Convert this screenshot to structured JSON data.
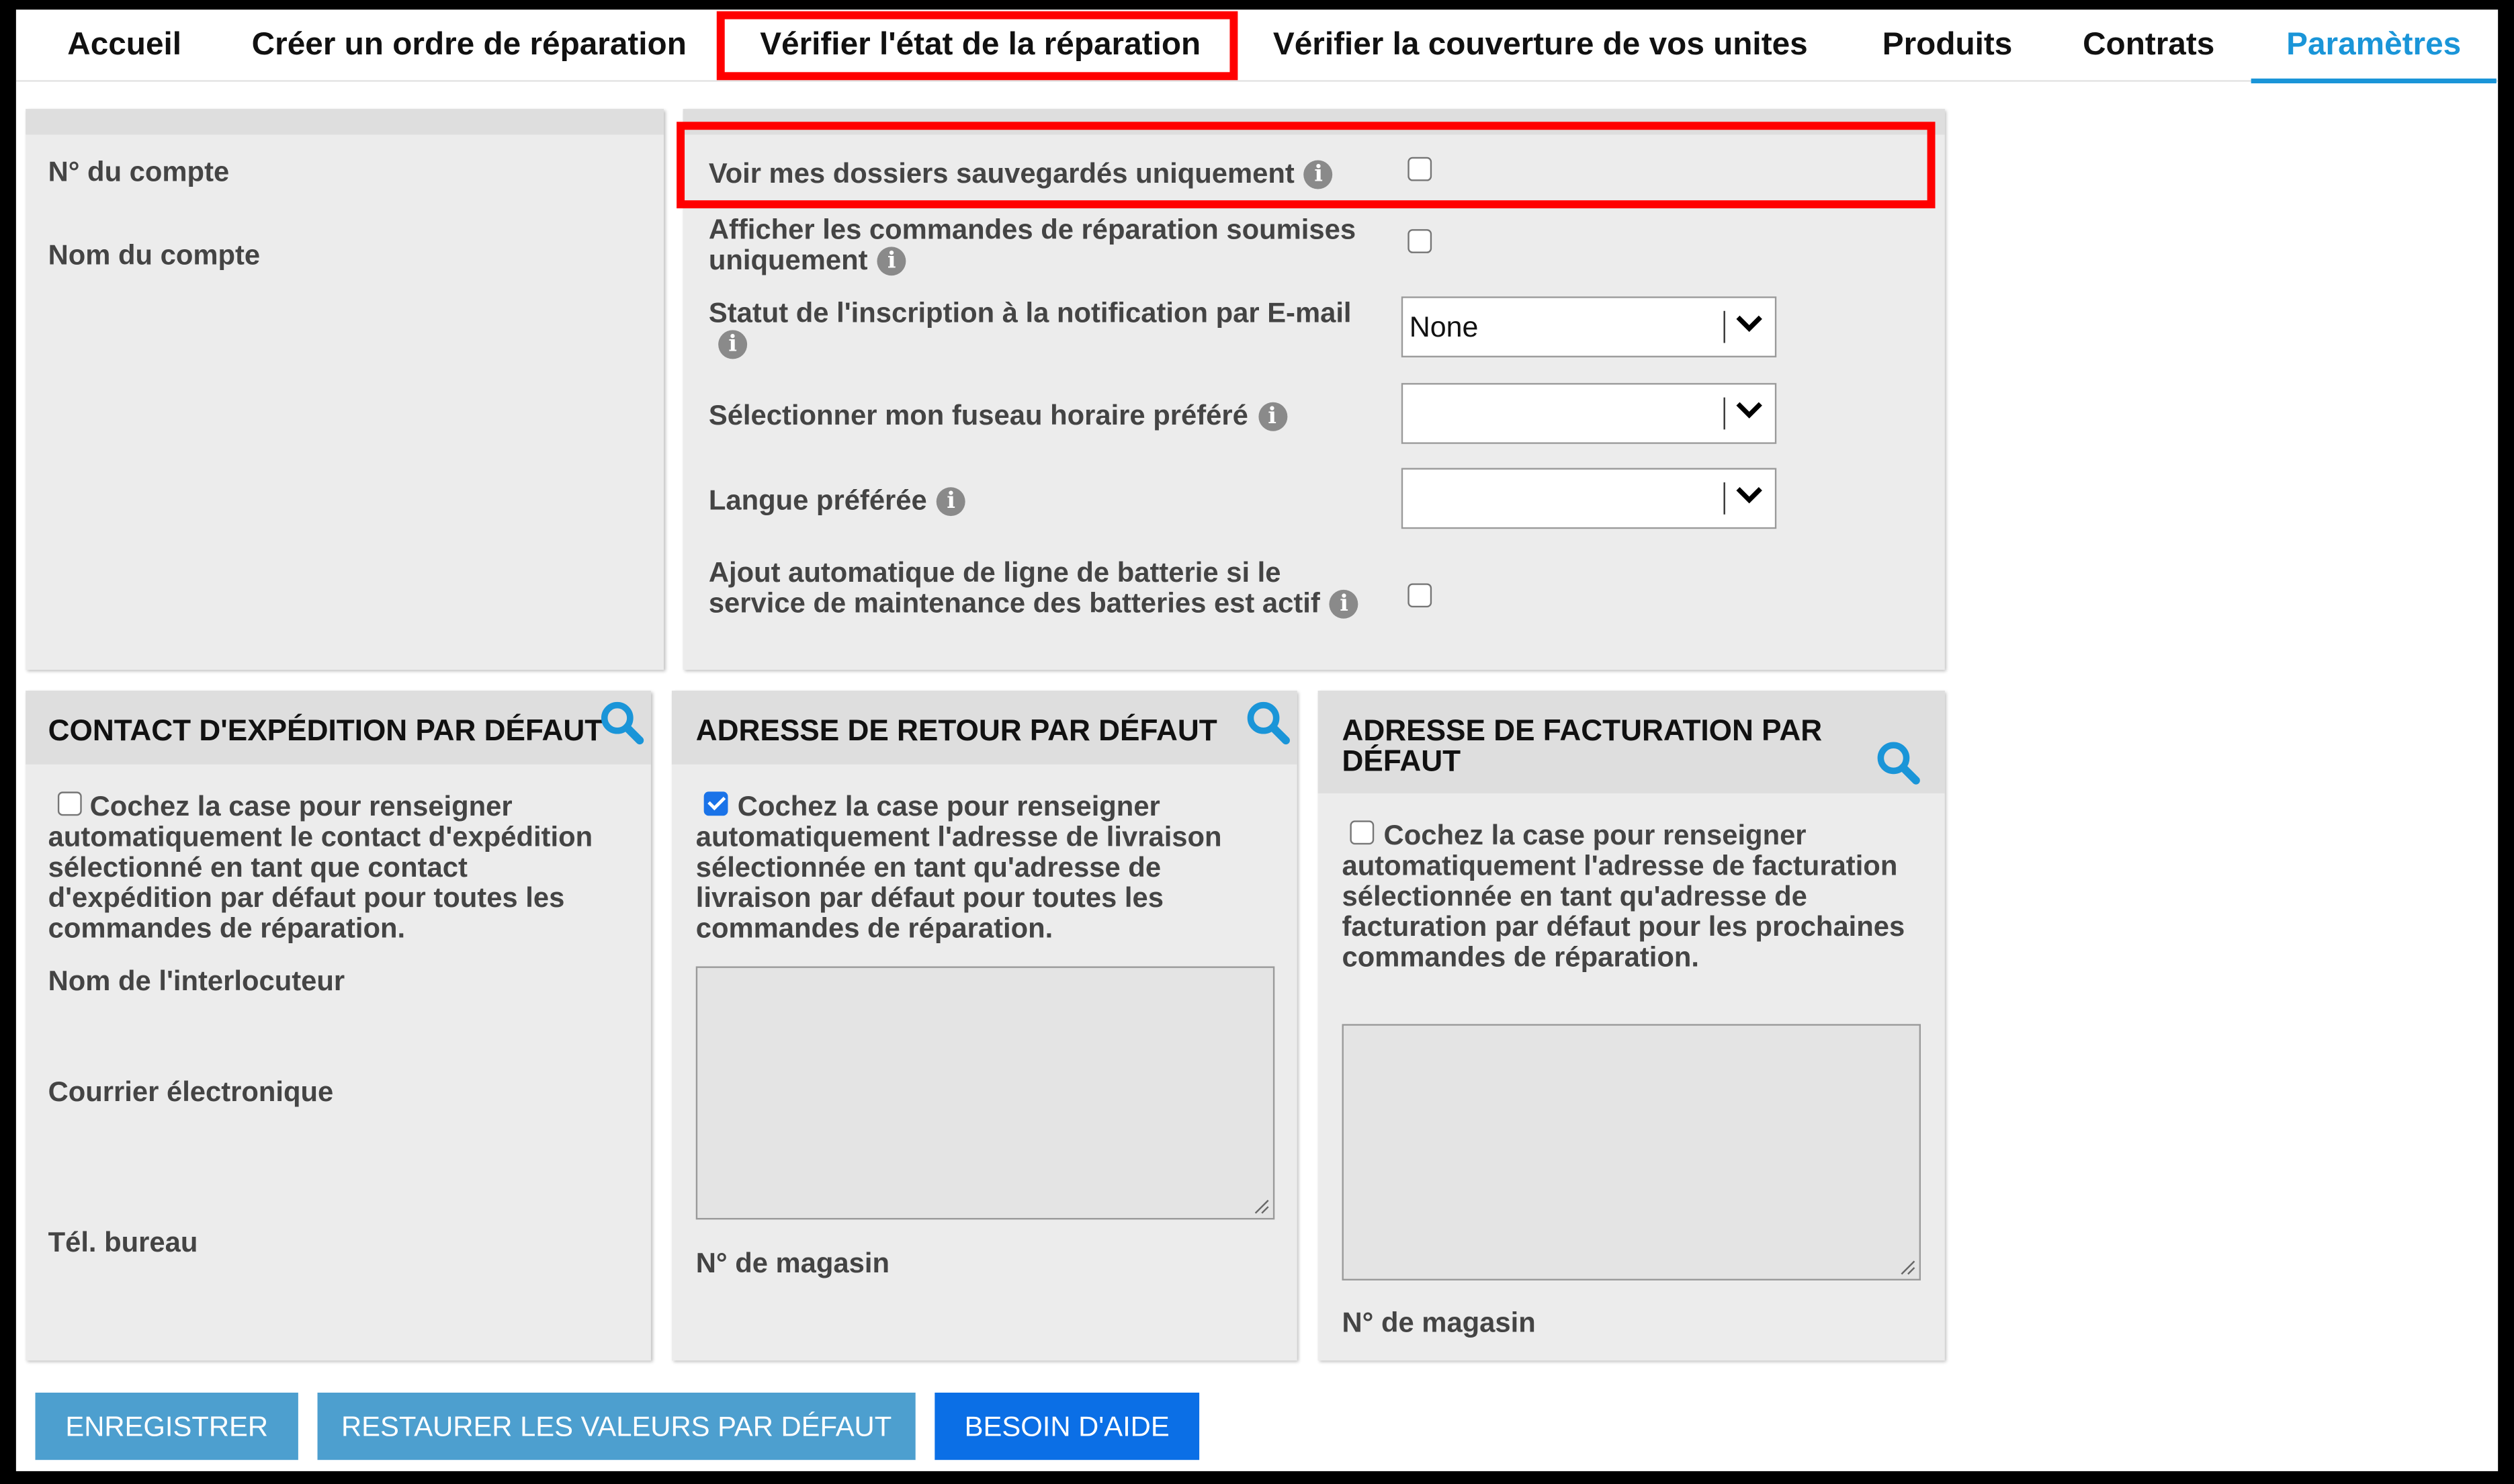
{
  "nav": {
    "tabs": [
      "Accueil",
      "Créer un ordre de réparation",
      "Vérifier l'état de la réparation",
      "Vérifier la couverture de vos unites",
      "Produits",
      "Contrats",
      "Paramètres"
    ],
    "active_tab": "Paramètres",
    "highlighted_tab": "Vérifier l'état de la réparation"
  },
  "account": {
    "number_label": "N° du compte",
    "name_label": "Nom du compte"
  },
  "settings": {
    "saved_only_label": "Voir mes dossiers sauvegardés uniquement",
    "saved_only_checked": false,
    "submitted_only_label": "Afficher les commandes de réparation soumises uniquement",
    "submitted_only_checked": false,
    "email_status_label": "Statut de l'inscription à la notification par E-mail",
    "email_status_value": "None",
    "timezone_label": "Sélectionner mon fuseau horaire préféré",
    "timezone_value": "",
    "language_label": "Langue préférée",
    "language_value": "",
    "battery_label": "Ajout automatique de ligne de batterie si le service de maintenance des batteries est actif",
    "battery_checked": false
  },
  "shipping": {
    "title": "CONTACT D'EXPÉDITION PAR DÉFAUT",
    "auto_label": "Cochez la case pour renseigner automatiquement le contact d'expédition sélectionné en tant que contact d'expédition par défaut pour toutes les commandes de réparation.",
    "auto_checked": false,
    "contact_label": "Nom de l'interlocuteur",
    "email_label": "Courrier électronique",
    "phone_label": "Tél. bureau"
  },
  "return_address": {
    "title": "ADRESSE DE RETOUR PAR DÉFAUT",
    "auto_label": "Cochez la case pour renseigner automatiquement l'adresse de livraison sélectionnée en tant qu'adresse de livraison par défaut pour toutes les commandes de réparation.",
    "auto_checked": true,
    "store_label": "N° de magasin"
  },
  "billing_address": {
    "title": "ADRESSE DE FACTURATION PAR DÉFAUT",
    "auto_label": "Cochez la case pour renseigner automatiquement l'adresse de facturation sélectionnée en tant qu'adresse de facturation par défaut pour les prochaines commandes de réparation.",
    "auto_checked": false,
    "store_label": "N° de magasin"
  },
  "buttons": {
    "save": "ENREGISTRER",
    "restore": "RESTAURER LES VALEURS PAR DÉFAUT",
    "help": "BESOIN D'AIDE"
  },
  "colors": {
    "accent": "#1a95d8",
    "highlight": "#ff0000",
    "button_muted": "#4d9fcf",
    "button_primary": "#0b6fe6",
    "panel_bg": "#ececec"
  }
}
